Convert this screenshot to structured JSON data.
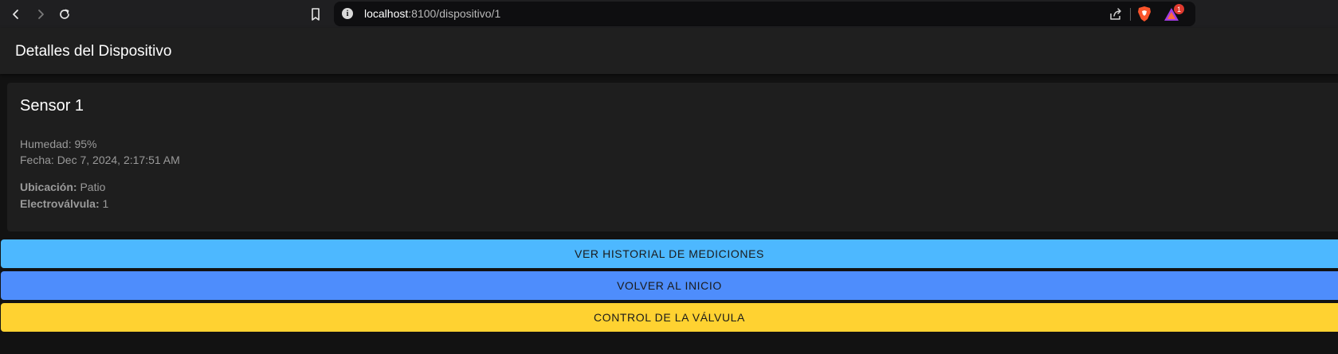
{
  "browser": {
    "url_host": "localhost",
    "url_rest": ":8100/dispositivo/1",
    "rewards_badge": "1",
    "icons": [
      "back-icon",
      "forward-icon",
      "reload-icon",
      "bookmark-icon",
      "site-info-icon",
      "share-icon",
      "brave-shield-icon",
      "brave-rewards-icon"
    ]
  },
  "header": {
    "title": "Detalles del Dispositivo"
  },
  "card": {
    "title": "Sensor 1",
    "humidity": "Humedad: 95%",
    "date": "Fecha: Dec 7, 2024, 2:17:51 AM",
    "location_label": "Ubicación:",
    "location_value": " Patio",
    "valve_label": "Electroválvula:",
    "valve_value": " 1"
  },
  "buttons": {
    "history": "VER HISTORIAL DE MEDICIONES",
    "home": "VOLVER AL INICIO",
    "valve_control": "CONTROL DE LA VÁLVULA"
  },
  "colors": {
    "history_button": "#4db8ff",
    "home_button": "#4e8dfc",
    "valve_button": "#ffd231",
    "background": "#121212",
    "card": "#1e1e1e"
  }
}
